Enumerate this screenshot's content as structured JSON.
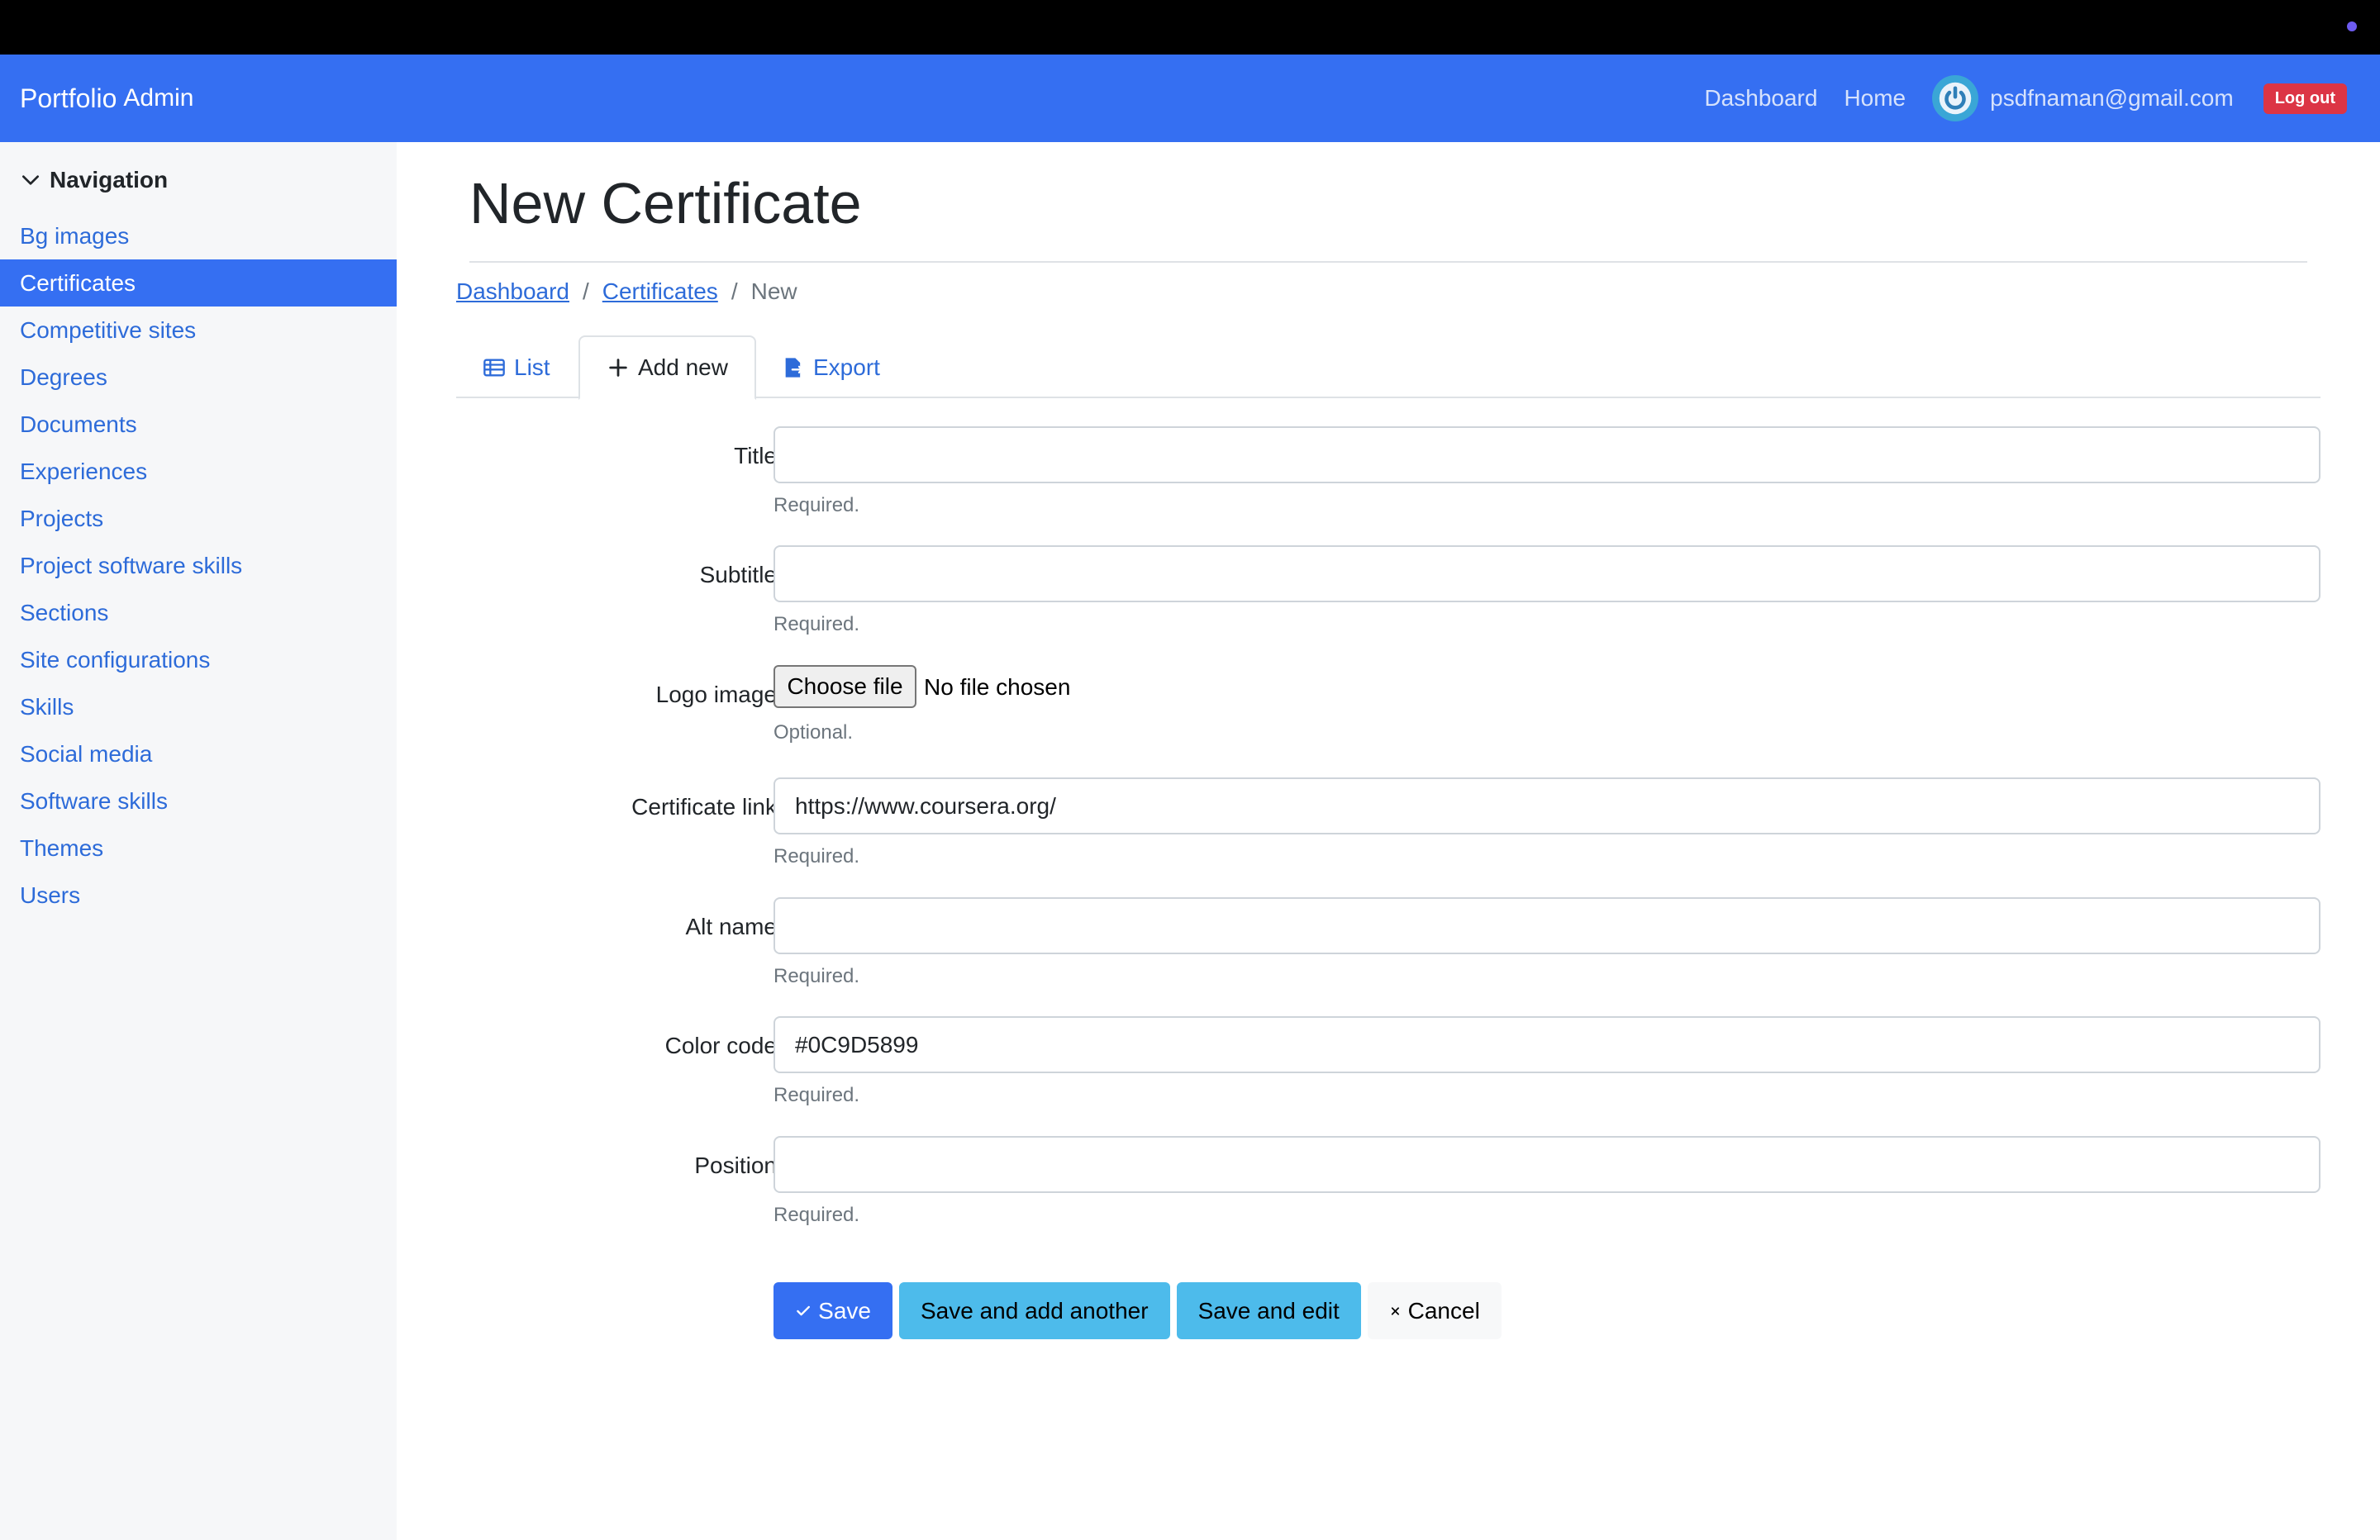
{
  "navbar": {
    "brand": "Portfolio",
    "brand_suffix": "Admin",
    "links": [
      "Dashboard",
      "Home"
    ],
    "user_email": "psdfnaman@gmail.com",
    "logout_label": "Log out"
  },
  "sidebar": {
    "heading": "Navigation",
    "items": [
      {
        "label": "Bg images",
        "active": false
      },
      {
        "label": "Certificates",
        "active": true
      },
      {
        "label": "Competitive sites",
        "active": false
      },
      {
        "label": "Degrees",
        "active": false
      },
      {
        "label": "Documents",
        "active": false
      },
      {
        "label": "Experiences",
        "active": false
      },
      {
        "label": "Projects",
        "active": false
      },
      {
        "label": "Project software skills",
        "active": false
      },
      {
        "label": "Sections",
        "active": false
      },
      {
        "label": "Site configurations",
        "active": false
      },
      {
        "label": "Skills",
        "active": false
      },
      {
        "label": "Social media",
        "active": false
      },
      {
        "label": "Software skills",
        "active": false
      },
      {
        "label": "Themes",
        "active": false
      },
      {
        "label": "Users",
        "active": false
      }
    ]
  },
  "page": {
    "title": "New Certificate",
    "breadcrumb": [
      "Dashboard",
      "Certificates",
      "New"
    ],
    "breadcrumb_sep": "/"
  },
  "tabs": [
    {
      "label": "List",
      "icon": "table-icon"
    },
    {
      "label": "Add new",
      "icon": "plus-icon"
    },
    {
      "label": "Export",
      "icon": "file-export-icon"
    }
  ],
  "form": {
    "fields": [
      {
        "label": "Title",
        "value": "",
        "help": "Required."
      },
      {
        "label": "Subtitle",
        "value": "",
        "help": "Required."
      },
      {
        "label": "Logo image",
        "type": "file",
        "button": "Choose file",
        "status": "No file chosen",
        "help": "Optional."
      },
      {
        "label": "Certificate link",
        "value": "https://www.coursera.org/",
        "help": "Required."
      },
      {
        "label": "Alt name",
        "value": "",
        "help": "Required."
      },
      {
        "label": "Color code",
        "value": "#0C9D5899",
        "help": "Required."
      },
      {
        "label": "Position",
        "value": "",
        "help": "Required."
      }
    ],
    "buttons": {
      "save": "Save",
      "save_add": "Save and add another",
      "save_edit": "Save and edit",
      "cancel": "Cancel"
    }
  },
  "colors": {
    "primary": "#356ff2",
    "info": "#4dbbeb",
    "danger": "#dc3545",
    "link": "#2d6bd9"
  }
}
